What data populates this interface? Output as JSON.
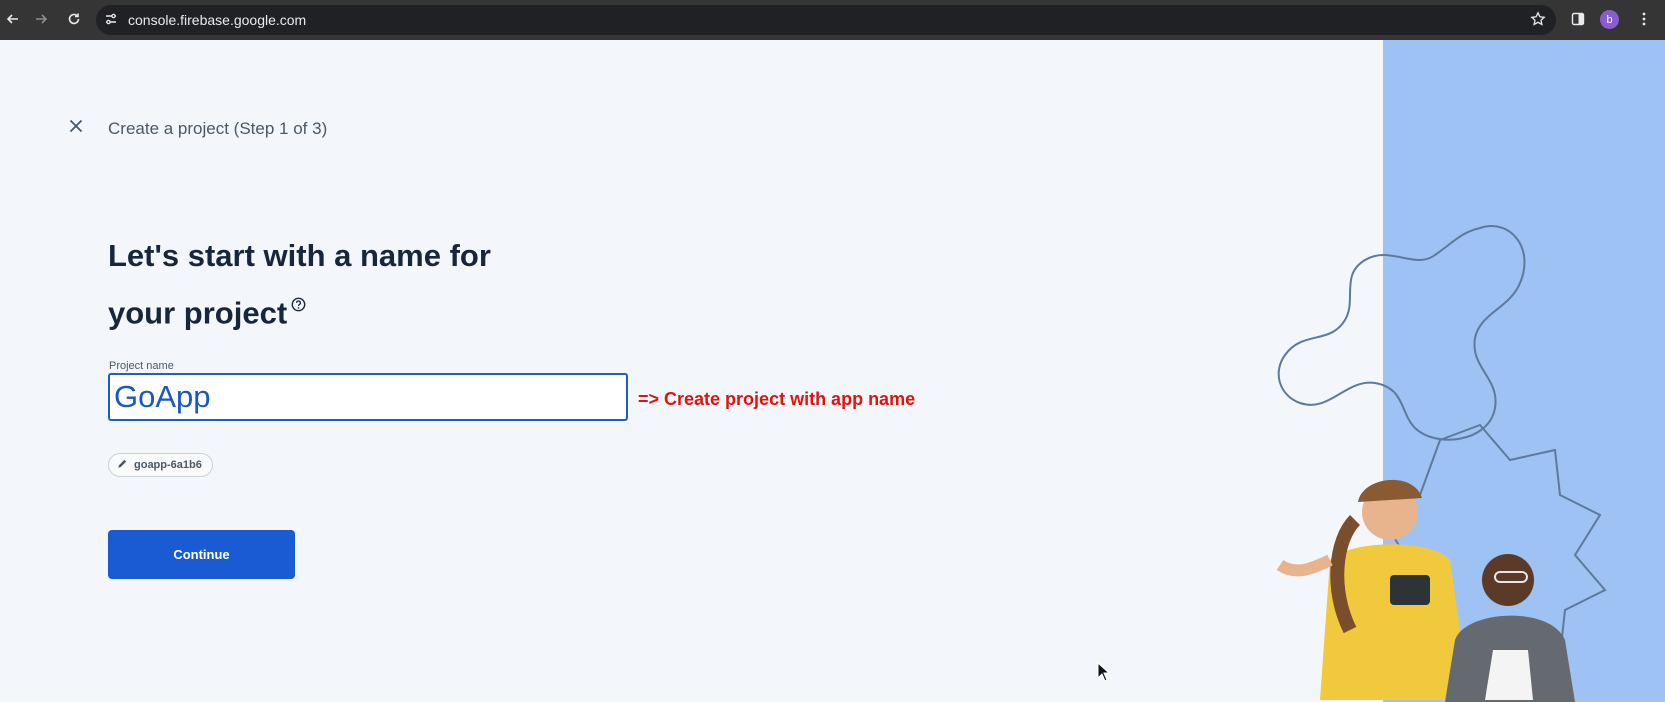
{
  "browser": {
    "url": "console.firebase.google.com",
    "avatar_letter": "b",
    "icons": [
      "back-arrow-icon",
      "forward-arrow-icon",
      "reload-icon",
      "site-settings-icon",
      "bookmark-star-icon",
      "side-panel-icon",
      "more-vert-icon"
    ]
  },
  "wizard": {
    "step_title": "Create a project (Step 1 of 3)",
    "heading_line1": "Let's start with a name for",
    "heading_line2": "your project",
    "field_label": "Project name",
    "field_value": "GoApp",
    "project_id": "goapp-6a1b6",
    "continue_label": "Continue"
  },
  "annotation": {
    "text": "=> Create project with app name",
    "color": "#e0140e"
  },
  "colors": {
    "accent": "#1a5ad2",
    "panel": "#9fc2f4",
    "page_background": "#f3f7fb"
  }
}
